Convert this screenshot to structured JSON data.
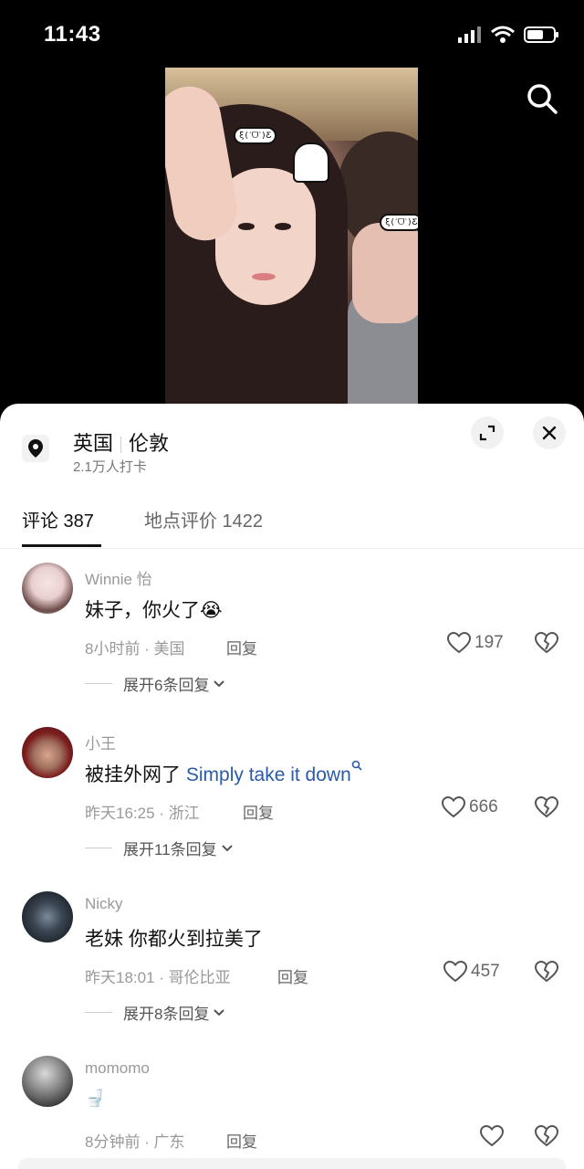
{
  "status_bar": {
    "time": "11:43"
  },
  "location": {
    "country": "英国",
    "city": "伦敦",
    "checkins": "2.1万人打卡"
  },
  "tabs": [
    {
      "label": "评论 387"
    },
    {
      "label": "地点评价 1422"
    }
  ],
  "comments": [
    {
      "user": "Winnie 怡",
      "text": "妹子，你火了",
      "emoji": "😭",
      "meta": "8小时前 · 美国",
      "reply_label": "回复",
      "likes": "197",
      "expand": "展开6条回复"
    },
    {
      "user": "小王",
      "text": "被挂外网了 ",
      "link_text": "Simply take it down",
      "meta": "昨天16:25 · 浙江",
      "reply_label": "回复",
      "likes": "666",
      "expand": "展开11条回复"
    },
    {
      "user": "Nicky",
      "text": "老妹 你都火到拉美了",
      "meta": "昨天18:01 · 哥伦比亚",
      "reply_label": "回复",
      "likes": "457",
      "expand": "展开8条回复"
    },
    {
      "user": "momomo",
      "text": "🚽",
      "meta": "8分钟前 · 广东",
      "reply_label": "回复",
      "likes": ""
    }
  ],
  "video_stickers": [
    "ξ(ˊᗜˋ)Ƹ",
    "ξ(ˊᗜˋ)Ƹ"
  ],
  "colors": {
    "link": "#2a5aa8",
    "sheet_bg": "#ffffff",
    "page_bg": "#000000"
  },
  "icons": [
    "search-icon",
    "location-pin-icon",
    "expand-icon",
    "close-icon",
    "heart-icon",
    "broken-heart-icon",
    "chevron-down-icon",
    "signal-icon",
    "wifi-icon",
    "battery-icon"
  ]
}
